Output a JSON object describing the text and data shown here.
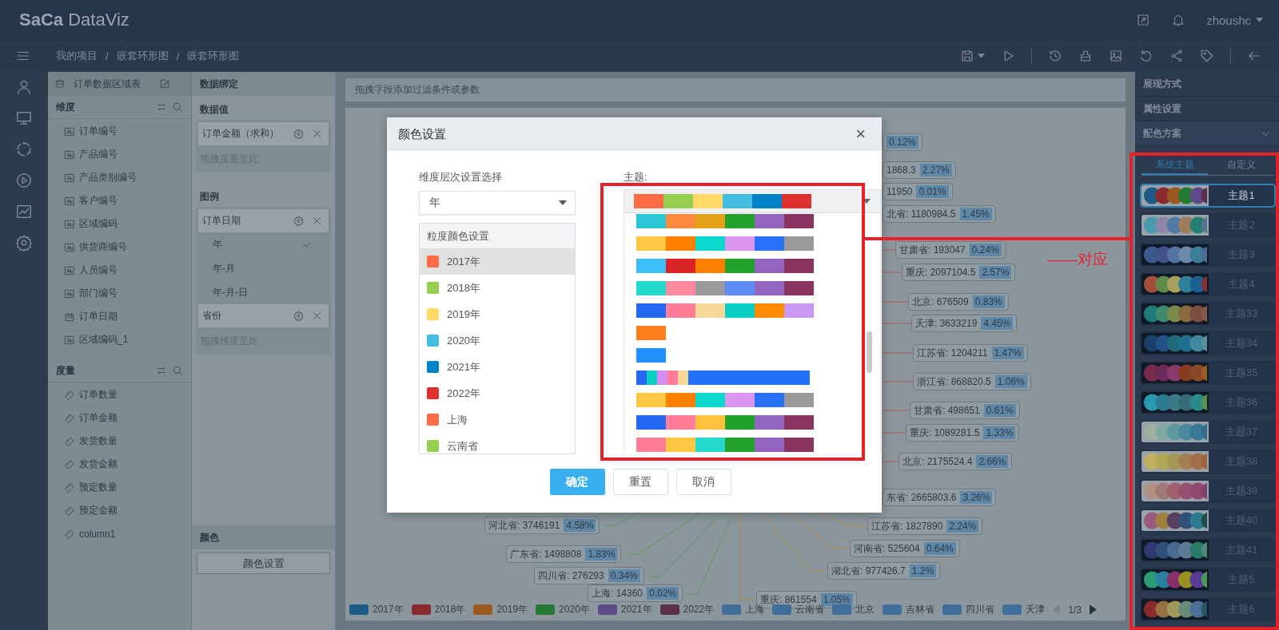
{
  "header": {
    "logo": "**SaCa** DataViz",
    "user": "zhoushc"
  },
  "breadcrumb": {
    "items": [
      "我的项目",
      "嵌套环形图",
      "嵌套环形图"
    ],
    "separator": "/"
  },
  "dataset": {
    "title": "订单数据区域表",
    "dimensions": {
      "title": "维度",
      "items": [
        {
          "label": "订单编号",
          "kind": "text"
        },
        {
          "label": "产品编号",
          "kind": "text"
        },
        {
          "label": "产品类别编号",
          "kind": "text"
        },
        {
          "label": "客户编号",
          "kind": "text"
        },
        {
          "label": "区域编码",
          "kind": "text"
        },
        {
          "label": "供货商编号",
          "kind": "text"
        },
        {
          "label": "人员编号",
          "kind": "text"
        },
        {
          "label": "部门编号",
          "kind": "text"
        },
        {
          "label": "订单日期",
          "kind": "date"
        },
        {
          "label": "区域编码_1",
          "kind": "text"
        }
      ]
    },
    "measures": {
      "title": "度量",
      "items": [
        "订单数量",
        "订单金额",
        "发货数量",
        "发货金额",
        "预定数量",
        "预定金额",
        "column1"
      ]
    }
  },
  "binding": {
    "title": "数据绑定",
    "value_section": {
      "title": "数据值",
      "fields": [
        {
          "label": "订单金额（求和）"
        }
      ],
      "placeholder": "拖拽度量至此"
    },
    "legend_section": {
      "title": "图例",
      "fields": [
        {
          "label": "订单日期",
          "options": [
            {
              "label": "年",
              "checked": true
            },
            {
              "label": "年-月",
              "checked": false
            },
            {
              "label": "年-月-日",
              "checked": false
            }
          ]
        },
        {
          "label": "省份"
        }
      ],
      "placeholder": "拖拽维度至此"
    },
    "color_section": {
      "title": "颜色",
      "button": "颜色设置"
    }
  },
  "filter_bar": {
    "placeholder": "拖拽字段添加过滤条件或参数"
  },
  "chart": {
    "labels": [
      {
        "pct": "0.12%"
      },
      {
        "name": "1868.3",
        "pct": "2.27%"
      },
      {
        "name": "11950",
        "pct": "0.01%"
      },
      {
        "name": "北省: 1180984.5",
        "pct": "1.45%"
      },
      {
        "name": "甘肃省: 193047",
        "pct": "0.24%"
      },
      {
        "name": "重庆: 2097104.5",
        "pct": "2.57%"
      },
      {
        "name": "北京: 676509",
        "pct": "0.83%"
      },
      {
        "name": "天津: 3633219",
        "pct": "4.45%"
      },
      {
        "name": "江苏省: 1204211",
        "pct": "1.47%"
      },
      {
        "name": "浙江省: 868820.5",
        "pct": "1.06%"
      },
      {
        "name": "甘肃省: 498651",
        "pct": "0.61%"
      },
      {
        "name": "重庆: 1089281.5",
        "pct": "1.33%"
      },
      {
        "name": "北京: 2175524.4",
        "pct": "2.66%"
      },
      {
        "name": "东省: 2665803.6",
        "pct": "3.26%"
      },
      {
        "name": "江苏省: 1827890",
        "pct": "2.24%"
      },
      {
        "name": "河南省: 525604",
        "pct": "0.64%"
      },
      {
        "name": "湖北省: 977426.7",
        "pct": "1.2%"
      },
      {
        "name": "河北省: 3746191",
        "pct": "4.58%"
      },
      {
        "name": "广东省: 1498808",
        "pct": "1.83%"
      },
      {
        "name": "四川省: 276293",
        "pct": "0.34%"
      },
      {
        "name": "上海: 14360",
        "pct": "0.02%"
      },
      {
        "name": "重庆: 861554",
        "pct": "1.05%"
      }
    ],
    "legend": [
      {
        "label": "2017年",
        "color": "#1d5a85"
      },
      {
        "label": "2018年",
        "color": "#8a2a2f"
      },
      {
        "label": "2019年",
        "color": "#9a5a1f"
      },
      {
        "label": "2020年",
        "color": "#257a33"
      },
      {
        "label": "2021年",
        "color": "#5e4a86"
      },
      {
        "label": "2022年",
        "color": "#5a2f4a"
      },
      {
        "label": "上海",
        "color": "#3f6e9a"
      },
      {
        "label": "云南省",
        "color": "#3f6e9a"
      },
      {
        "label": "北京",
        "color": "#3f6e9a"
      },
      {
        "label": "吉林省",
        "color": "#3f6e9a"
      },
      {
        "label": "四川省",
        "color": "#3f6e9a"
      },
      {
        "label": "天津",
        "color": "#3f6e9a"
      }
    ],
    "pager": "1/3"
  },
  "dialog": {
    "title": "颜色设置",
    "close": "×",
    "dimension_label": "维度层次设置选择",
    "dimension_value": "年",
    "granularity_title": "粒度颜色设置",
    "granularity": [
      {
        "label": "2017年",
        "color": "#ff6b45",
        "selected": true
      },
      {
        "label": "2018年",
        "color": "#96cf50",
        "selected": false
      },
      {
        "label": "2019年",
        "color": "#ffd865",
        "selected": false
      },
      {
        "label": "2020年",
        "color": "#44bde0",
        "selected": false
      },
      {
        "label": "2021年",
        "color": "#0082c8",
        "selected": false
      },
      {
        "label": "2022年",
        "color": "#e0302e",
        "selected": false
      },
      {
        "label": "上海",
        "color": "#ff6b45",
        "selected": false
      },
      {
        "label": "云南省",
        "color": "#96cf50",
        "selected": false
      }
    ],
    "theme_label": "主题:",
    "theme_value": [
      {
        "color": "#ff6b45"
      },
      {
        "color": "#96cf50"
      },
      {
        "color": "#ffd865"
      },
      {
        "color": "#44bde0"
      },
      {
        "color": "#0082c8"
      },
      {
        "color": "#e0302e"
      }
    ],
    "palettes": [
      {
        "kind": "standard",
        "colors": [
          {
            "color": "#2ac6d6"
          },
          {
            "color": "#ff8a3d"
          },
          {
            "color": "#e6a117"
          },
          {
            "color": "#22a22a"
          },
          {
            "color": "#9364c0"
          },
          {
            "color": "#8a3460"
          }
        ]
      },
      {
        "kind": "standard",
        "colors": [
          {
            "color": "#ffc843"
          },
          {
            "color": "#ff7f00"
          },
          {
            "color": "#0ad8cc"
          },
          {
            "color": "#dc96f0"
          },
          {
            "color": "#2870f5"
          },
          {
            "color": "#9a9a9a"
          }
        ]
      },
      {
        "kind": "standard",
        "colors": [
          {
            "color": "#3dbef8"
          },
          {
            "color": "#d92424"
          },
          {
            "color": "#ff7f00"
          },
          {
            "color": "#22a22a"
          },
          {
            "color": "#9364c0"
          },
          {
            "color": "#8a3460"
          }
        ]
      },
      {
        "kind": "standard",
        "colors": [
          {
            "color": "#25d8cc"
          },
          {
            "color": "#ff8aa0"
          },
          {
            "color": "#9a9a9a"
          },
          {
            "color": "#5b8cf5"
          },
          {
            "color": "#9364c0"
          },
          {
            "color": "#8a3460"
          }
        ]
      },
      {
        "kind": "standard",
        "colors": [
          {
            "color": "#2468f2"
          },
          {
            "color": "#ff7d96"
          },
          {
            "color": "#f8d898"
          },
          {
            "color": "#0acfc3"
          },
          {
            "color": "#ff8c00"
          },
          {
            "color": "#c998f0"
          }
        ]
      },
      {
        "kind": "standard",
        "colors": [
          {
            "color": "#ff7f20"
          }
        ]
      },
      {
        "kind": "standard",
        "colors": [
          {
            "color": "#1e90ff"
          }
        ]
      },
      {
        "kind": "compact",
        "colors": [
          {
            "color": "#2468f2"
          },
          {
            "color": "#0acfc3"
          },
          {
            "color": "#d38cf0"
          },
          {
            "color": "#ff7d96"
          },
          {
            "color": "#f8d898"
          },
          {
            "color": "#2170f8"
          }
        ]
      },
      {
        "kind": "standard",
        "colors": [
          {
            "color": "#ffc843"
          },
          {
            "color": "#ff7f00"
          },
          {
            "color": "#0ad8cc"
          },
          {
            "color": "#dc96f0"
          },
          {
            "color": "#2870f5"
          },
          {
            "color": "#9a9a9a"
          }
        ]
      },
      {
        "kind": "standard",
        "colors": [
          {
            "color": "#2468f2"
          },
          {
            "color": "#ff7d96"
          },
          {
            "color": "#ffc23e"
          },
          {
            "color": "#22a22a"
          },
          {
            "color": "#9364c0"
          },
          {
            "color": "#8a3460"
          }
        ]
      },
      {
        "kind": "standard",
        "colors": [
          {
            "color": "#ff7d96"
          },
          {
            "color": "#ffc843"
          },
          {
            "color": "#25d8cc"
          },
          {
            "color": "#22a22a"
          },
          {
            "color": "#9364c0"
          },
          {
            "color": "#8a3460"
          }
        ]
      }
    ],
    "buttons": [
      {
        "label": "确定",
        "kind": "primary"
      },
      {
        "label": "重置",
        "kind": "default"
      },
      {
        "label": "取消",
        "kind": "default"
      }
    ]
  },
  "right_panel": {
    "sections": [
      {
        "label": "展现方式",
        "expanded": false
      },
      {
        "label": "属性设置",
        "expanded": false
      },
      {
        "label": "配色方案",
        "expanded": true
      }
    ],
    "tabs": [
      {
        "label": "系统主题",
        "selected": true
      },
      {
        "label": "自定义",
        "selected": false
      }
    ],
    "themes": [
      {
        "name": "主题1",
        "selected": true,
        "light_ground": true,
        "colors": [
          {
            "color": "#1d5a85"
          },
          {
            "color": "#8a2a2f"
          },
          {
            "color": "#9a5a1f"
          },
          {
            "color": "#257a33"
          },
          {
            "color": "#5e4a86"
          },
          {
            "color": "#5a2f4a"
          }
        ]
      },
      {
        "name": "主题2",
        "selected": false,
        "light_ground": true,
        "colors": [
          {
            "color": "#4a9bb0"
          },
          {
            "color": "#8d85a8"
          },
          {
            "color": "#4e7aa5"
          },
          {
            "color": "#a07c5c"
          },
          {
            "color": "#238073"
          },
          {
            "color": "#5a7394"
          }
        ]
      },
      {
        "name": "主题3",
        "selected": false,
        "light_ground": false,
        "colors": [
          {
            "color": "#3a5a8e"
          },
          {
            "color": "#44528a"
          },
          {
            "color": "#5373a3"
          },
          {
            "color": "#6b8aa8"
          },
          {
            "color": "#3a7e9a"
          },
          {
            "color": "#4e6a90"
          }
        ]
      },
      {
        "name": "主题4",
        "selected": false,
        "light_ground": false,
        "colors": [
          {
            "color": "#a24f3f"
          },
          {
            "color": "#5f8a4a"
          },
          {
            "color": "#a5a05a"
          },
          {
            "color": "#2f8098"
          },
          {
            "color": "#1a6090"
          },
          {
            "color": "#8a2f2f"
          }
        ]
      },
      {
        "name": "主题33",
        "selected": false,
        "light_ground": false,
        "colors": [
          {
            "color": "#1f7a7a"
          },
          {
            "color": "#3f8a6a"
          },
          {
            "color": "#7a8a4a"
          },
          {
            "color": "#8a6a3f"
          },
          {
            "color": "#7a4f3f"
          },
          {
            "color": "#8a5a4f"
          }
        ]
      },
      {
        "name": "主题34",
        "selected": false,
        "light_ground": false,
        "colors": [
          {
            "color": "#1a3f6a"
          },
          {
            "color": "#24508a"
          },
          {
            "color": "#1f6a7a"
          },
          {
            "color": "#1f7090"
          },
          {
            "color": "#3f8aa0"
          },
          {
            "color": "#5a90a0"
          }
        ]
      },
      {
        "name": "主题35",
        "selected": false,
        "light_ground": false,
        "colors": [
          {
            "color": "#7a2a4a"
          },
          {
            "color": "#6a2a5a"
          },
          {
            "color": "#8a3a6a"
          },
          {
            "color": "#8a3a1f"
          },
          {
            "color": "#8a4a2a"
          },
          {
            "color": "#9a5f24"
          }
        ]
      },
      {
        "name": "主题36",
        "selected": false,
        "light_ground": false,
        "colors": [
          {
            "color": "#2a9ab0"
          },
          {
            "color": "#2a7a90"
          },
          {
            "color": "#3a7a88"
          },
          {
            "color": "#3a6a78"
          },
          {
            "color": "#2a8a8a"
          },
          {
            "color": "#5a9050"
          }
        ]
      },
      {
        "name": "主题37",
        "selected": false,
        "light_ground": true,
        "colors": [
          {
            "color": "#a0b0a0"
          },
          {
            "color": "#80a8a0"
          },
          {
            "color": "#6098a0"
          },
          {
            "color": "#4a88a0"
          },
          {
            "color": "#3a7898"
          },
          {
            "color": "#336a90"
          }
        ]
      },
      {
        "name": "主题38",
        "selected": false,
        "light_ground": true,
        "colors": [
          {
            "color": "#c0b060"
          },
          {
            "color": "#b0a858"
          },
          {
            "color": "#a89858"
          },
          {
            "color": "#a08050"
          },
          {
            "color": "#a07048"
          },
          {
            "color": "#a06040"
          }
        ]
      },
      {
        "name": "主题39",
        "selected": false,
        "light_ground": true,
        "colors": [
          {
            "color": "#b09080"
          },
          {
            "color": "#a07878"
          },
          {
            "color": "#a06070"
          },
          {
            "color": "#985070"
          },
          {
            "color": "#904870"
          },
          {
            "color": "#803e6a"
          }
        ]
      },
      {
        "name": "主题40",
        "selected": false,
        "light_ground": true,
        "colors": [
          {
            "color": "#9a5a80"
          },
          {
            "color": "#a08040"
          },
          {
            "color": "#5a4060"
          },
          {
            "color": "#2f5078"
          },
          {
            "color": "#2f7a90"
          },
          {
            "color": "#1f5048"
          }
        ]
      },
      {
        "name": "主题41",
        "selected": false,
        "light_ground": false,
        "colors": [
          {
            "color": "#2f3a70"
          },
          {
            "color": "#2f5078"
          },
          {
            "color": "#4a6a90"
          },
          {
            "color": "#5f7a98"
          },
          {
            "color": "#2a7a68"
          },
          {
            "color": "#4f8a78"
          }
        ]
      },
      {
        "name": "主题5",
        "selected": false,
        "light_ground": false,
        "colors": [
          {
            "color": "#2a9a70"
          },
          {
            "color": "#2a80a0"
          },
          {
            "color": "#8a2f6a"
          },
          {
            "color": "#9a9020"
          },
          {
            "color": "#5a3a98"
          },
          {
            "color": "#4a9a58"
          }
        ]
      },
      {
        "name": "主题6",
        "selected": false,
        "light_ground": false,
        "colors": [
          {
            "color": "#8a2a2a"
          },
          {
            "color": "#9a7040"
          },
          {
            "color": "#a09a5a"
          },
          {
            "color": "#6a8a78"
          },
          {
            "color": "#4a7098"
          },
          {
            "color": "#2a5560"
          }
        ]
      }
    ]
  },
  "annotation": {
    "text": "——对应"
  }
}
